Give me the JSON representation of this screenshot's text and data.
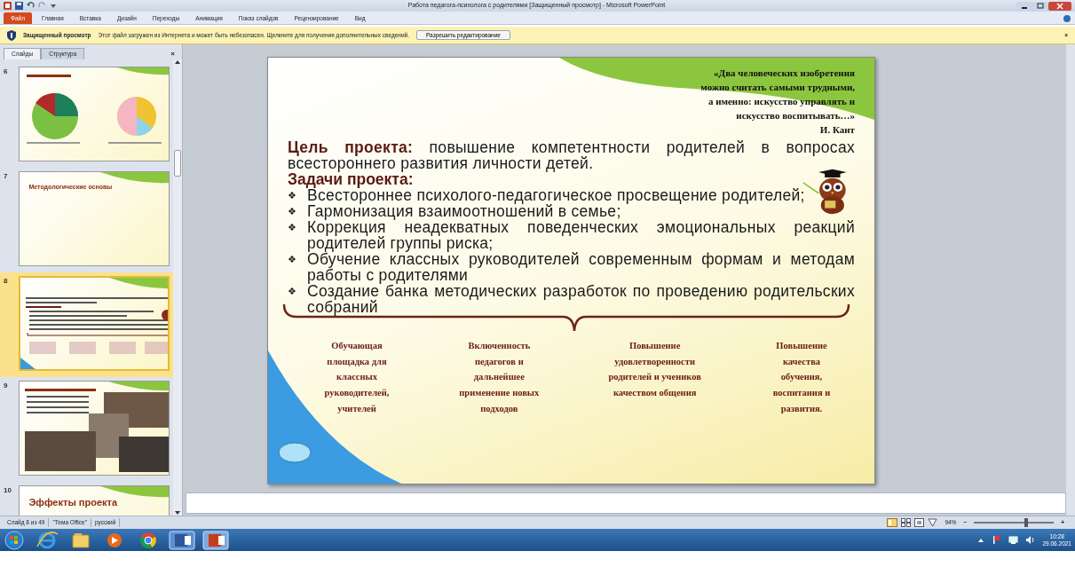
{
  "window": {
    "title": "Работа педагога-психолога с родителями [Защищенный просмотр] - Microsoft PowerPoint"
  },
  "ribbon": {
    "file_button": "Файл",
    "tabs": [
      {
        "label": "Главная",
        "selected": false
      },
      {
        "label": "Вставка",
        "selected": false
      },
      {
        "label": "Дизайн",
        "selected": false
      },
      {
        "label": "Переходы",
        "selected": false
      },
      {
        "label": "Анимация",
        "selected": false
      },
      {
        "label": "Показ слайдов",
        "selected": false
      },
      {
        "label": "Рецензирование",
        "selected": false
      },
      {
        "label": "Вид",
        "selected": false
      }
    ]
  },
  "message_bar": {
    "title": "Защищенный просмотр",
    "text": "Этот файл загружен из Интернета и может быть небезопасен. Щелкните для получения дополнительных сведений.",
    "button": "Разрешить редактирование",
    "close": "×"
  },
  "slides_panel": {
    "tabs": [
      {
        "label": "Слайды",
        "selected": true
      },
      {
        "label": "Структура",
        "selected": false
      }
    ],
    "close": "×",
    "thumbnails": [
      {
        "number": "6",
        "kind": "charts",
        "selected": false
      },
      {
        "number": "7",
        "kind": "bullets",
        "title": "Методологические основы",
        "selected": false
      },
      {
        "number": "8",
        "kind": "current",
        "selected": true
      },
      {
        "number": "9",
        "kind": "photos",
        "selected": false
      },
      {
        "number": "10",
        "kind": "title",
        "title": "Эффекты проекта",
        "selected": false
      }
    ]
  },
  "slide": {
    "quote_lines": [
      "«Два человеческих изобретения",
      "можно считать самыми трудными,",
      "а именно: искусство управлять и",
      "искусство воспитывать…»"
    ],
    "quote_author": "И. Кант",
    "goal": "**Цель проекта:** повышение компетентности родителей в вопросах всестороннего развития личности детей.",
    "tasks_heading": "Задачи проекта:",
    "tasks": [
      {
        "bullet": "❖",
        "text": "Всестороннее психолого-педагогическое просвещение родителей;"
      },
      {
        "bullet": "❖",
        "text": "Гармонизация взаимоотношений в семье;"
      },
      {
        "bullet": "❖",
        "text": "Коррекция неадекватных поведенческих эмоциональных реакций родителей группы риска;"
      },
      {
        "bullet": "❖",
        "text": "Обучение классных руководителей современным формам и методам работы с родителями"
      },
      {
        "bullet": "❖",
        "text": "Создание банка методических разработок по проведению родительских собраний"
      }
    ],
    "results": [
      "Обучающая\nплощадка для\nклассных\nруководителей,\nучителей",
      "Включенность\nпедагогов и\nдальнейшее\nприменение новых\nподходов",
      "Повышение\nудовлетворенности\nродителей и учеников\nкачеством общения",
      "Повышение\nкачества\nобучения,\nвоспитания и\nразвития."
    ]
  },
  "status_bar": {
    "slide_info": "Слайд 8 из 49",
    "theme": "\"Тема Office\"",
    "language": "русский",
    "zoom": "94%",
    "zoom_minus": "−",
    "zoom_plus": "+",
    "zoom_slider": {
      "level": 0.65
    }
  },
  "taskbar": {
    "time": "10:28",
    "date": "29.06.2021"
  }
}
